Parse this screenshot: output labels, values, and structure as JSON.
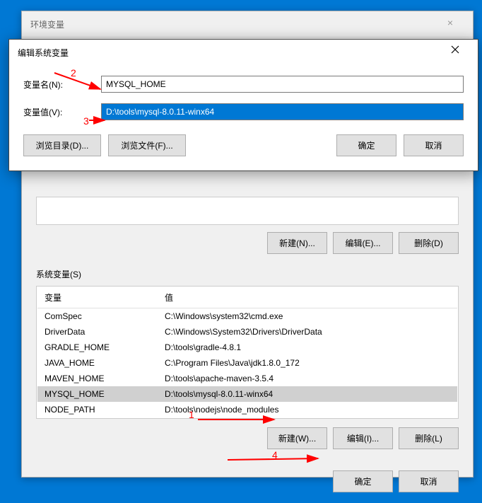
{
  "main": {
    "title": "环境变量",
    "user_buttons": {
      "new": "新建(N)...",
      "edit": "编辑(E)...",
      "delete": "删除(D)"
    },
    "sys_label": "系统变量(S)",
    "sys_headers": {
      "name": "变量",
      "value": "值"
    },
    "sys_vars": [
      {
        "name": "ComSpec",
        "value": "C:\\Windows\\system32\\cmd.exe"
      },
      {
        "name": "DriverData",
        "value": "C:\\Windows\\System32\\Drivers\\DriverData"
      },
      {
        "name": "GRADLE_HOME",
        "value": "D:\\tools\\gradle-4.8.1"
      },
      {
        "name": "JAVA_HOME",
        "value": "C:\\Program Files\\Java\\jdk1.8.0_172"
      },
      {
        "name": "MAVEN_HOME",
        "value": "D:\\tools\\apache-maven-3.5.4"
      },
      {
        "name": "MYSQL_HOME",
        "value": "D:\\tools\\mysql-8.0.11-winx64",
        "selected": true
      },
      {
        "name": "NODE_PATH",
        "value": "D:\\tools\\nodejs\\node_modules"
      }
    ],
    "sys_buttons": {
      "new": "新建(W)...",
      "edit": "编辑(I)...",
      "delete": "删除(L)"
    },
    "footer": {
      "ok": "确定",
      "cancel": "取消"
    }
  },
  "edit": {
    "title": "编辑系统变量",
    "name_label": "变量名(N):",
    "name_value": "MYSQL_HOME",
    "value_label": "变量值(V):",
    "value_value": "D:\\tools\\mysql-8.0.11-winx64",
    "browse_dir": "浏览目录(D)...",
    "browse_file": "浏览文件(F)...",
    "ok": "确定",
    "cancel": "取消"
  },
  "annotations": {
    "n1": "1",
    "n2": "2",
    "n3": "3",
    "n4": "4"
  }
}
